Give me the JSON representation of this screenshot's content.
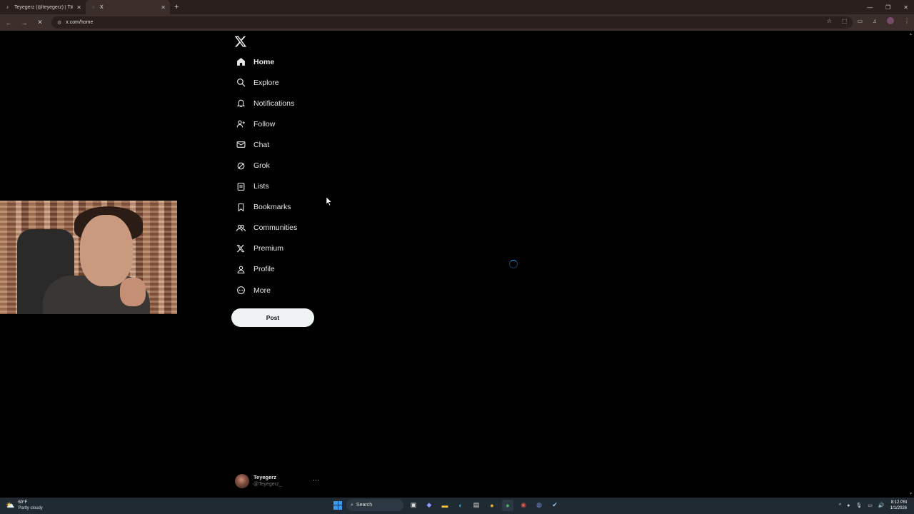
{
  "browser": {
    "tabs": [
      {
        "title": "Teyegerz (@teyegerz) | TikTok",
        "favicon": "tiktok-icon",
        "active": false
      },
      {
        "title": "X",
        "favicon": "x-icon",
        "active": true
      }
    ],
    "url": "x.com/home"
  },
  "sidebar": {
    "items": [
      {
        "label": "Home",
        "icon": "home-icon",
        "active": true
      },
      {
        "label": "Explore",
        "icon": "search-icon"
      },
      {
        "label": "Notifications",
        "icon": "bell-icon"
      },
      {
        "label": "Follow",
        "icon": "follow-icon"
      },
      {
        "label": "Chat",
        "icon": "envelope-icon"
      },
      {
        "label": "Grok",
        "icon": "grok-icon"
      },
      {
        "label": "Lists",
        "icon": "list-icon"
      },
      {
        "label": "Bookmarks",
        "icon": "bookmark-icon"
      },
      {
        "label": "Communities",
        "icon": "communities-icon"
      },
      {
        "label": "Premium",
        "icon": "x-icon"
      },
      {
        "label": "Profile",
        "icon": "person-icon"
      },
      {
        "label": "More",
        "icon": "more-circle-icon"
      }
    ],
    "post_label": "Post"
  },
  "account": {
    "name": "Teyegerz",
    "handle": "@Teyegerz_",
    "more": "···"
  },
  "taskbar": {
    "weather_temp": "60°F",
    "weather_cond": "Partly cloudy",
    "search_placeholder": "Search",
    "time": "8:12 PM",
    "date": "1/1/2026"
  },
  "colors": {
    "background": "#000000",
    "text": "#e7e9ea",
    "post_button": "#eff3f4",
    "accent": "#1d9bf0"
  }
}
